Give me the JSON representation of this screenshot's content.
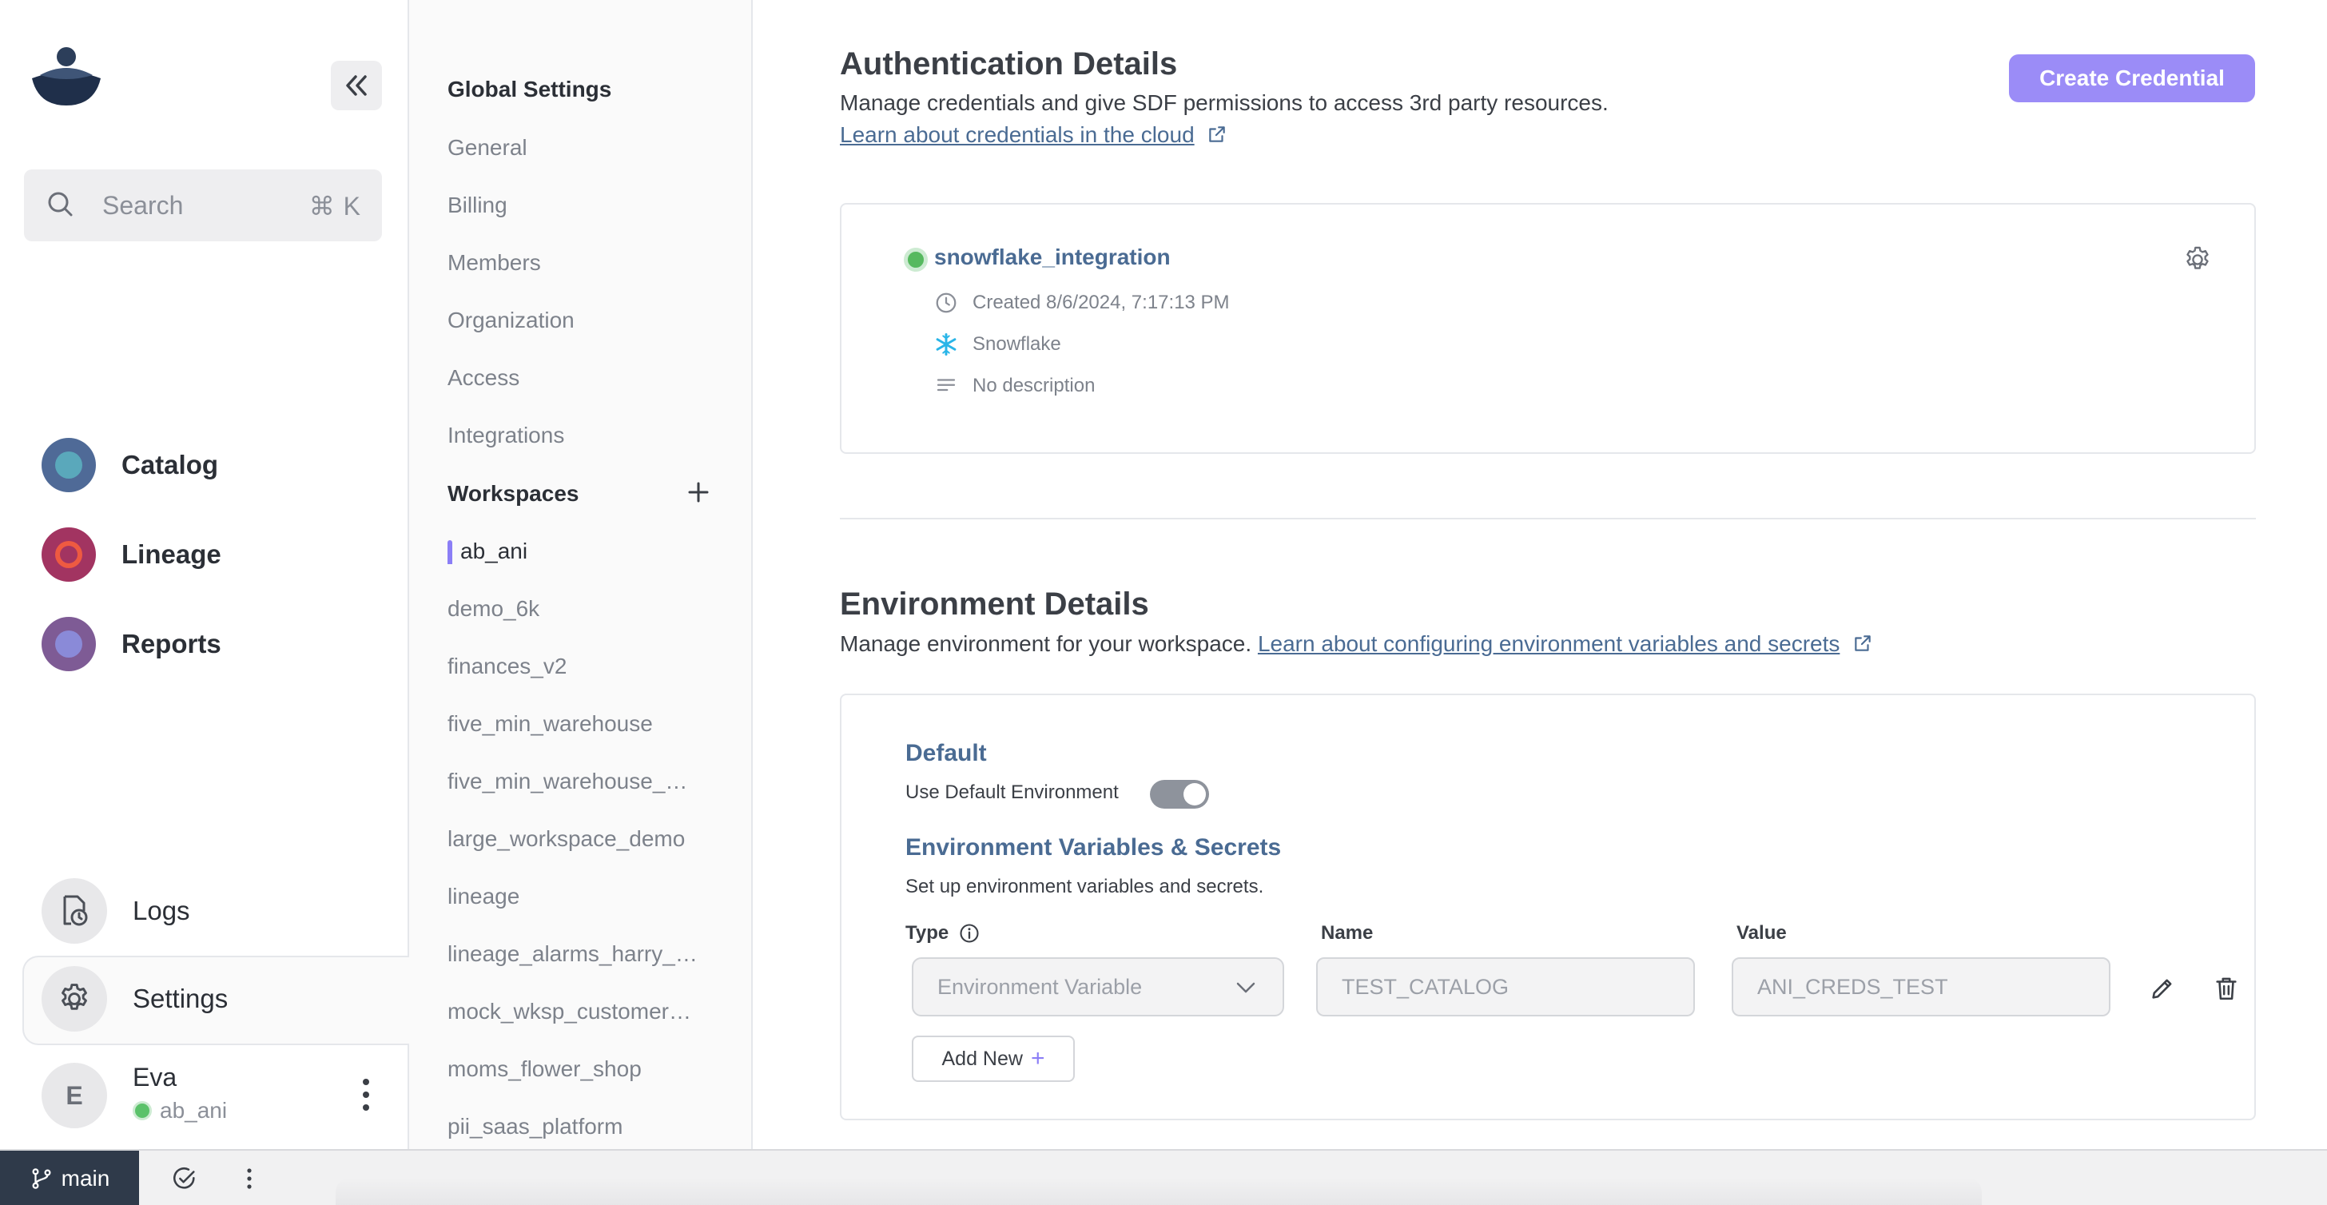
{
  "sidebar": {
    "search_placeholder": "Search",
    "search_shortcut": "⌘ K",
    "apps": [
      {
        "label": "Catalog",
        "icon": "catalog-icon"
      },
      {
        "label": "Lineage",
        "icon": "lineage-icon"
      },
      {
        "label": "Reports",
        "icon": "reports-icon"
      }
    ],
    "logs_label": "Logs",
    "settings_label": "Settings",
    "user": {
      "initial": "E",
      "name": "Eva",
      "workspace": "ab_ani"
    }
  },
  "settings_nav": {
    "global_heading": "Global Settings",
    "global_items": [
      "General",
      "Billing",
      "Members",
      "Organization",
      "Access",
      "Integrations"
    ],
    "workspaces_heading": "Workspaces",
    "workspaces": [
      "ab_ani",
      "demo_6k",
      "finances_v2",
      "five_min_warehouse",
      "five_min_warehouse_…",
      "large_workspace_demo",
      "lineage",
      "lineage_alarms_harry_…",
      "mock_wksp_customer…",
      "moms_flower_shop",
      "pii_saas_platform"
    ],
    "active_workspace": "ab_ani"
  },
  "auth": {
    "title": "Authentication Details",
    "description": "Manage credentials and give SDF permissions to access 3rd party resources.",
    "learn_link": "Learn about credentials in the cloud",
    "create_button": "Create Credential",
    "credential": {
      "name": "snowflake_integration",
      "created": "Created 8/6/2024, 7:17:13 PM",
      "provider": "Snowflake",
      "description": "No description"
    }
  },
  "env": {
    "title": "Environment Details",
    "description": "Manage environment for your workspace.",
    "learn_link": "Learn about configuring environment variables and secrets",
    "default_label": "Default",
    "use_default_label": "Use Default Environment",
    "use_default_on": true,
    "vars_title": "Environment Variables & Secrets",
    "vars_subtitle": "Set up environment variables and secrets.",
    "col_type": "Type",
    "col_name": "Name",
    "col_value": "Value",
    "row": {
      "type": "Environment Variable",
      "name": "TEST_CATALOG",
      "value": "ANI_CREDS_TEST"
    },
    "add_new": "Add New"
  },
  "statusbar": {
    "branch": "main"
  },
  "colors": {
    "accent": "#9b8cf7",
    "link": "#4a6b93",
    "status_green": "#56b95f",
    "branch_bg": "#2f3a4a"
  }
}
